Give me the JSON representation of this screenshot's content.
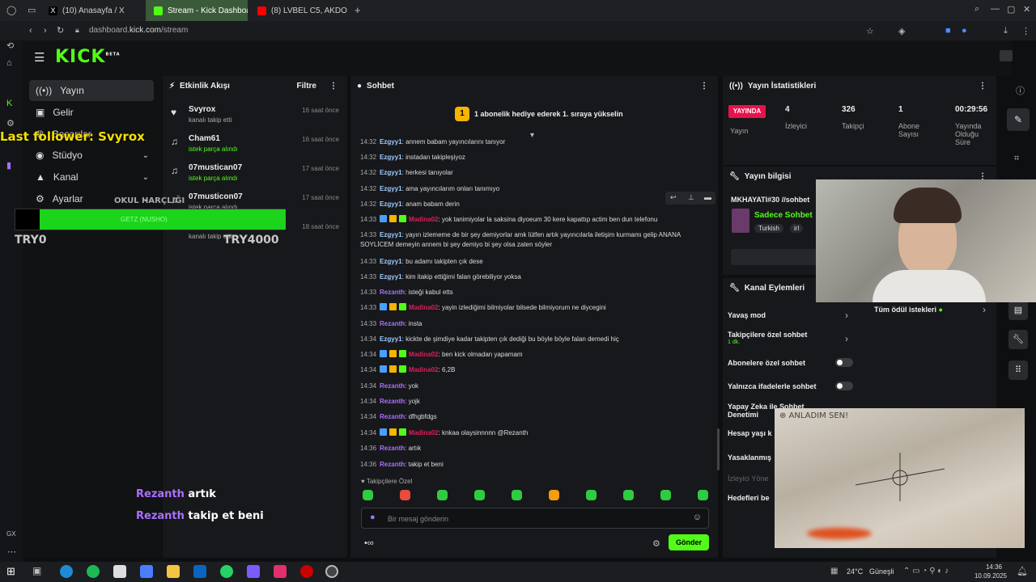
{
  "browser": {
    "tabs": [
      {
        "label": "(10) Anasayfa / X",
        "favicon": "x-icon"
      },
      {
        "label": "Stream - Kick Dashboard",
        "favicon": "kick-icon"
      },
      {
        "label": "(8) LVBEL C5, AKDO",
        "favicon": "youtube-icon"
      }
    ],
    "url_prefix": "dashboard.",
    "url_domain": "kick.com",
    "url_path": "/stream"
  },
  "app": {
    "logo": "KICK",
    "logo_badge": "BETA",
    "nav": [
      {
        "label": "Yayın",
        "icon": "broadcast-icon",
        "active": true
      },
      {
        "label": "Gelir",
        "icon": "money-icon"
      },
      {
        "label": "Başarılar",
        "icon": "trophy-icon"
      },
      {
        "label": "Stüdyo",
        "icon": "studio-icon",
        "chevron": true
      },
      {
        "label": "Kanal",
        "icon": "channel-icon",
        "chevron": true
      },
      {
        "label": "Ayarlar",
        "icon": "gear-icon",
        "chevron": true
      }
    ]
  },
  "activity": {
    "title": "Etkinlik Akışı",
    "filter": "Filtre",
    "items": [
      {
        "name": "Svyrox",
        "sub": "kanalı takip etti",
        "time": "16 saat önce",
        "sub_green": false
      },
      {
        "name": "Cham61",
        "sub": "istek parça alındı",
        "time": "16 saat önce",
        "sub_green": true
      },
      {
        "name": "07mustican07",
        "sub": "istek parça alındı",
        "time": "17 saat önce",
        "sub_green": true
      },
      {
        "name": "07musticon07",
        "sub": "istek parça alındı",
        "time": "17 saat önce",
        "sub_green": false
      },
      {
        "name": "",
        "sub": "kanalı takip etti",
        "time": "18 saat önce",
        "sub_green": false
      }
    ]
  },
  "chat": {
    "title": "Sohbet",
    "promo": "1 abonelik hediye ederek 1. sıraya yükselin",
    "promo_rank": "1",
    "messages": [
      {
        "time": "14:32",
        "user": "Ezgyy1",
        "cls": "u-e",
        "text": "annem babam yayıncılarını tanıyor",
        "badges": false
      },
      {
        "time": "14:32",
        "user": "Ezgyy1",
        "cls": "u-e",
        "text": "instadan takipleşiyoz",
        "badges": false
      },
      {
        "time": "14:32",
        "user": "Ezgyy1",
        "cls": "u-e",
        "text": "herkesi tanıyolar",
        "badges": false
      },
      {
        "time": "14:32",
        "user": "Ezgyy1",
        "cls": "u-e",
        "text": "ama yayıncılarım onları tanımıyo",
        "badges": false
      },
      {
        "time": "14:32",
        "user": "Ezgyy1",
        "cls": "u-e",
        "text": "anam babam derin",
        "badges": false
      },
      {
        "time": "14:33",
        "user": "Madina02",
        "cls": "u-m",
        "text": "yok tanimiyolar la saksina diyoeum 30 kere kapattıp actim ben dun telefonu",
        "badges": true
      },
      {
        "time": "14:33",
        "user": "Ezgyy1",
        "cls": "u-e",
        "text": "yayın izlememe de bir şey demiyorlar amk lütfen artık yayıncılarla iletişim kurmamı gelip ANANA SOYLİCEM demeyin annem bi şey demiyo bi şey olsa zaten söyler",
        "badges": false
      },
      {
        "time": "14:33",
        "user": "Ezgyy1",
        "cls": "u-e",
        "text": "bu adamı takipten çık dese",
        "badges": false
      },
      {
        "time": "14:33",
        "user": "Ezgyy1",
        "cls": "u-e",
        "text": "kim itakip ettiğimi falan görebiliyor yoksa",
        "badges": false
      },
      {
        "time": "14:33",
        "user": "Rezanth",
        "cls": "u-r",
        "text": "isteği kabul etts",
        "badges": false
      },
      {
        "time": "14:33",
        "user": "Madina02",
        "cls": "u-m",
        "text": "yayin izlediğimi bilmiyolar bilsede bilmiyorum ne diycegini",
        "badges": true
      },
      {
        "time": "14:33",
        "user": "Rezanth",
        "cls": "u-r",
        "text": "insta",
        "badges": false
      },
      {
        "time": "14:34",
        "user": "Ezgyy1",
        "cls": "u-e",
        "text": "kickte de şimdiye kadar takipten çık dediği bu böyle böyle falan demedi hiç",
        "badges": false
      },
      {
        "time": "14:34",
        "user": "Madina02",
        "cls": "u-m",
        "text": "ben kick olmadan yapamam",
        "badges": true
      },
      {
        "time": "14:34",
        "user": "Madina02",
        "cls": "u-m",
        "text": "6,2B",
        "badges": true
      },
      {
        "time": "14:34",
        "user": "Rezanth",
        "cls": "u-r",
        "text": "yok",
        "badges": false
      },
      {
        "time": "14:34",
        "user": "Rezanth",
        "cls": "u-r",
        "text": "yojk",
        "badges": false
      },
      {
        "time": "14:34",
        "user": "Rezanth",
        "cls": "u-r",
        "text": "dfhgbfdgs",
        "badges": false
      },
      {
        "time": "14:34",
        "user": "Madina02",
        "cls": "u-m",
        "text": "knkaa olaysinnnnn @Rezanth",
        "badges": true
      },
      {
        "time": "14:36",
        "user": "Rezanth",
        "cls": "u-r",
        "text": "artık",
        "badges": false
      },
      {
        "time": "14:36",
        "user": "Rezanth",
        "cls": "u-r",
        "text": "takip et beni",
        "badges": false
      }
    ],
    "followers_only": "Takipçilere Özel",
    "input_placeholder": "Bir mesaj gönderin",
    "send_label": "Gönder"
  },
  "stats": {
    "title": "Yayın İstatistikleri",
    "live_badge": "YAYINDA",
    "live_label": "Yayın",
    "viewers": "4",
    "viewers_label": "İzleyici",
    "followers": "326",
    "followers_label": "Takipçi",
    "subs": "1",
    "subs_label": "Abone Sayısı",
    "duration": "00:29:56",
    "duration_label": "Yayında Olduğu Süre"
  },
  "stream_info": {
    "title": "Yayın bilgisi",
    "stream_title": "MKHAYATI#30 //sohbet",
    "category": "Sadece Sohbet",
    "tags": [
      "Turkish",
      "irl"
    ]
  },
  "channel_actions": {
    "title": "Kanal Eylemleri",
    "slow_mode": "Yavaş mod",
    "followers_chat": "Takipçilere özel sohbet",
    "followers_chat_sub": "1 dk.",
    "subs_chat": "Abonelere özel sohbet",
    "emotes_chat": "Yalnızca ifadelerle sohbet",
    "ai_moderation": "Yapay Zeka ile Sohbet Denetimi",
    "account_age": "Hesap yaşı k",
    "banned": "Yasaklanmış",
    "moderators": "İzleyici Yöne",
    "goals": "Hedefleri be",
    "rewards": "Tüm ödül istekleri"
  },
  "overlay": {
    "last_follower": "Last follower: Svyrox",
    "school": "OKUL HARÇLIĞI",
    "goal_bar": "GETZ (NUSHO)",
    "goal_progress": 1.0,
    "goal_min": "TRY0",
    "goal_max": "TRY4000",
    "chat_lines": [
      {
        "user": "Rezanth",
        "text": "artık"
      },
      {
        "user": "Rezanth",
        "text": "takip et beni"
      }
    ],
    "paper_text": "ANLADIM SEN!"
  },
  "taskbar": {
    "weather": "24°C",
    "weather_label": "Güneşli",
    "time": "14:36",
    "date": "10.09.2025"
  },
  "colors": {
    "accent": "#53fc18",
    "live": "#e8124c"
  }
}
